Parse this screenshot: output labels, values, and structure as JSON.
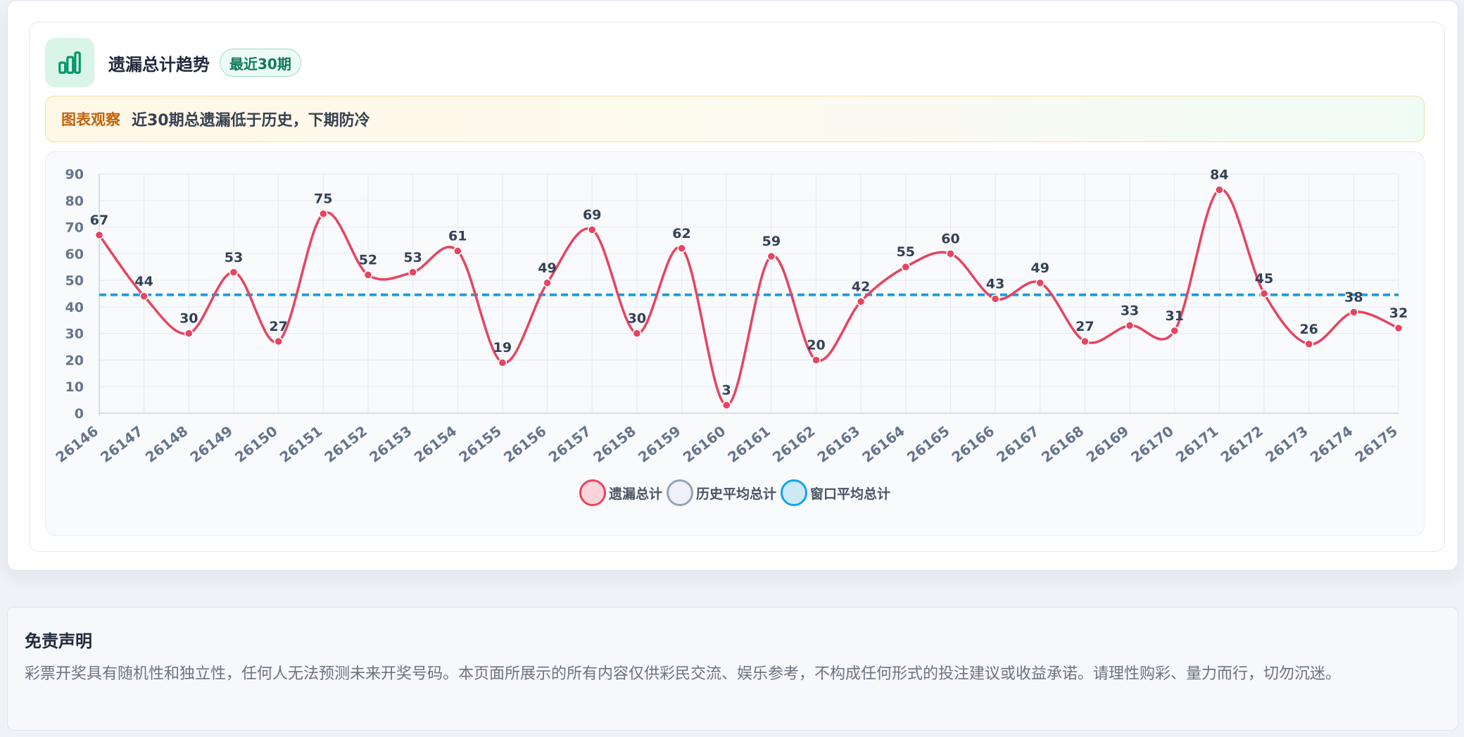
{
  "header": {
    "title": "遗漏总计趋势",
    "badge": "最近30期",
    "icon": "bar-chart-icon",
    "icon_color": "#059669"
  },
  "insight": {
    "label": "图表观察",
    "text": "近30期总遗漏低于历史，下期防冷"
  },
  "colors": {
    "series_main": "#e8435f",
    "series_history": "#64748b",
    "series_window": "#0ea5e9"
  },
  "legend": [
    {
      "label": "遗漏总计",
      "border": "#e8435f",
      "fill": "#fcd3da"
    },
    {
      "label": "历史平均总计",
      "border": "#94a3b8",
      "fill": "#eef1f5"
    },
    {
      "label": "窗口平均总计",
      "border": "#0ea5e9",
      "fill": "#cde9f8"
    }
  ],
  "chart_data": {
    "type": "line",
    "x": [
      "26146",
      "26147",
      "26148",
      "26149",
      "26150",
      "26151",
      "26152",
      "26153",
      "26154",
      "26155",
      "26156",
      "26157",
      "26158",
      "26159",
      "26160",
      "26161",
      "26162",
      "26163",
      "26164",
      "26165",
      "26166",
      "26167",
      "26168",
      "26169",
      "26170",
      "26171",
      "26172",
      "26173",
      "26174",
      "26175"
    ],
    "series": [
      {
        "name": "遗漏总计",
        "values": [
          67,
          44,
          30,
          53,
          27,
          75,
          52,
          53,
          61,
          19,
          49,
          69,
          30,
          62,
          3,
          59,
          20,
          42,
          55,
          60,
          43,
          49,
          27,
          33,
          31,
          84,
          45,
          26,
          38,
          32
        ]
      },
      {
        "name": "历史平均总计",
        "values": [
          44.6,
          44.6,
          44.6,
          44.6,
          44.6,
          44.6,
          44.6,
          44.6,
          44.6,
          44.6,
          44.6,
          44.6,
          44.6,
          44.6,
          44.6,
          44.6,
          44.6,
          44.6,
          44.6,
          44.6,
          44.6,
          44.6,
          44.6,
          44.6,
          44.6,
          44.6,
          44.6,
          44.6,
          44.6,
          44.6
        ]
      },
      {
        "name": "窗口平均总计",
        "values": [
          44.4,
          44.4,
          44.4,
          44.4,
          44.4,
          44.4,
          44.4,
          44.4,
          44.4,
          44.4,
          44.4,
          44.4,
          44.4,
          44.4,
          44.4,
          44.4,
          44.4,
          44.4,
          44.4,
          44.4,
          44.4,
          44.4,
          44.4,
          44.4,
          44.4,
          44.4,
          44.4,
          44.4,
          44.4,
          44.4
        ]
      }
    ],
    "yticks": [
      0,
      10,
      20,
      30,
      40,
      50,
      60,
      70,
      80,
      90
    ],
    "ylim": [
      0,
      90
    ],
    "grid": true,
    "legend_position": "bottom-center"
  },
  "disclaimer": {
    "title": "免责声明",
    "text": "彩票开奖具有随机性和独立性，任何人无法预测未来开奖号码。本页面所展示的所有内容仅供彩民交流、娱乐参考，不构成任何形式的投注建议或收益承诺。请理性购彩、量力而行，切勿沉迷。"
  }
}
